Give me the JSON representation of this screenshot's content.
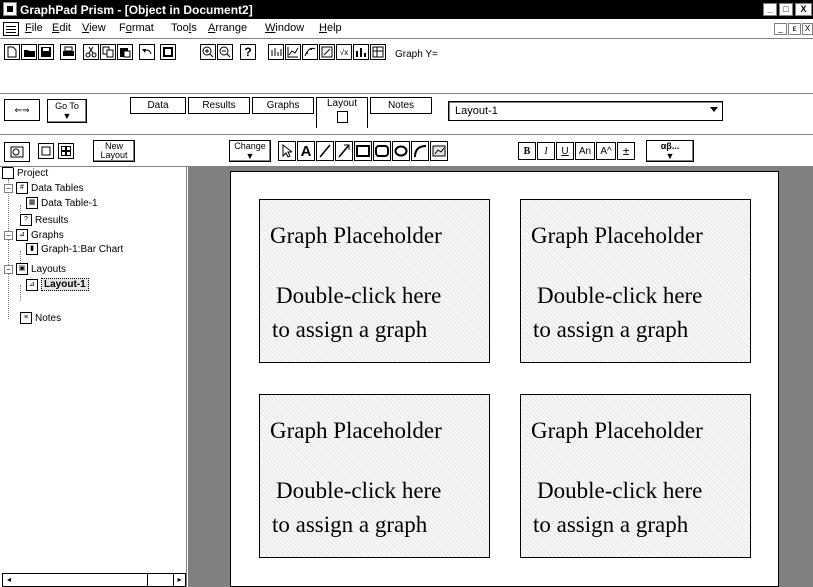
{
  "app": {
    "title": "GraphPad Prism - [Object in Document2]"
  },
  "window_controls": {
    "minimize": "_",
    "restore": "□",
    "close": "X",
    "mdi_minimize": "_",
    "mdi_restore": "ᴇ"
  },
  "menubar": {
    "items": [
      {
        "pre": "",
        "u": "F",
        "post": "ile"
      },
      {
        "pre": "",
        "u": "E",
        "post": "dit"
      },
      {
        "pre": "",
        "u": "V",
        "post": "iew"
      },
      {
        "pre": "F",
        "u": "o",
        "post": "rmat"
      },
      {
        "pre": "Too",
        "u": "l",
        "post": "s"
      },
      {
        "pre": "",
        "u": "A",
        "post": "rrange"
      },
      {
        "pre": "",
        "u": "W",
        "post": "indow"
      },
      {
        "pre": "",
        "u": "H",
        "post": "elp"
      }
    ]
  },
  "toolbar": {
    "graph_y_label": "Graph Y="
  },
  "navigator": {
    "goto_label": "Go To",
    "tabs": [
      "Data",
      "Results",
      "Graphs",
      "Layout",
      "Notes"
    ],
    "active_tab": "Layout",
    "sheet_selector": "Layout-1"
  },
  "layout_toolbar": {
    "new_layout_label": "New Layout",
    "change_label": "Change",
    "bold_glyph": "B",
    "italic_glyph": "I",
    "underline_glyph": "U",
    "subscript_glyph": "An",
    "superscript_glyph": "A^",
    "plusminus_glyph": "±",
    "greek_label": "αβ..."
  },
  "sidebar": {
    "root": "Project",
    "sections": {
      "data_tables": "Data Tables",
      "data_table_1": "Data Table-1",
      "results": "Results",
      "graphs": "Graphs",
      "graph_1": "Graph-1:Bar Chart",
      "layouts": "Layouts",
      "layout_1": "Layout-1",
      "notes": "Notes"
    },
    "selected": "Layout-1"
  },
  "layout": {
    "placeholders": [
      {
        "heading": "Graph Placeholder",
        "line1": "Double-click here",
        "line2": "to assign a graph"
      },
      {
        "heading": "Graph Placeholder",
        "line1": "Double-click here",
        "line2": "to assign a graph"
      },
      {
        "heading": "Graph Placeholder",
        "line1": "Double-click here",
        "line2": "to assign a graph"
      },
      {
        "heading": "Graph Placeholder",
        "line1": "Double-click here",
        "line2": "to assign a graph"
      }
    ]
  }
}
